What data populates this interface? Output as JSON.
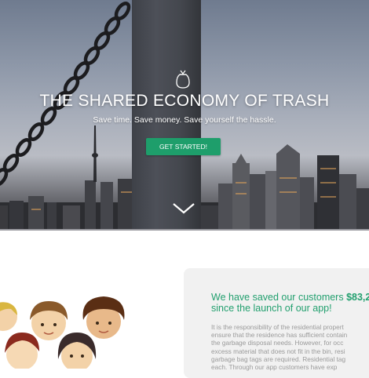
{
  "hero": {
    "title": "THE SHARED ECONOMY OF TRASH",
    "subtitle": "Save time. Save money. Save yourself the hassle.",
    "cta_label": "GET STARTED!",
    "icons": [
      "trash-bag-icon",
      "chevron-down-icon"
    ]
  },
  "savings": {
    "headline_prefix": "We have saved our customers ",
    "amount": "$83,2",
    "headline_suffix": "since the launch of our app!",
    "body_lines": [
      "It is the responsibility of the residential propert",
      "ensure that the residence has sufficient contain",
      "the garbage disposal needs. However, for occ",
      "excess material that does not fit in the bin, resi",
      "garbage bag tags are required. Residential tag",
      "each. Through our app customers have exp"
    ]
  },
  "colors": {
    "accent_green": "#1e9e6b",
    "headline_green": "#23a06f",
    "card_bg": "#f1f1f1"
  }
}
